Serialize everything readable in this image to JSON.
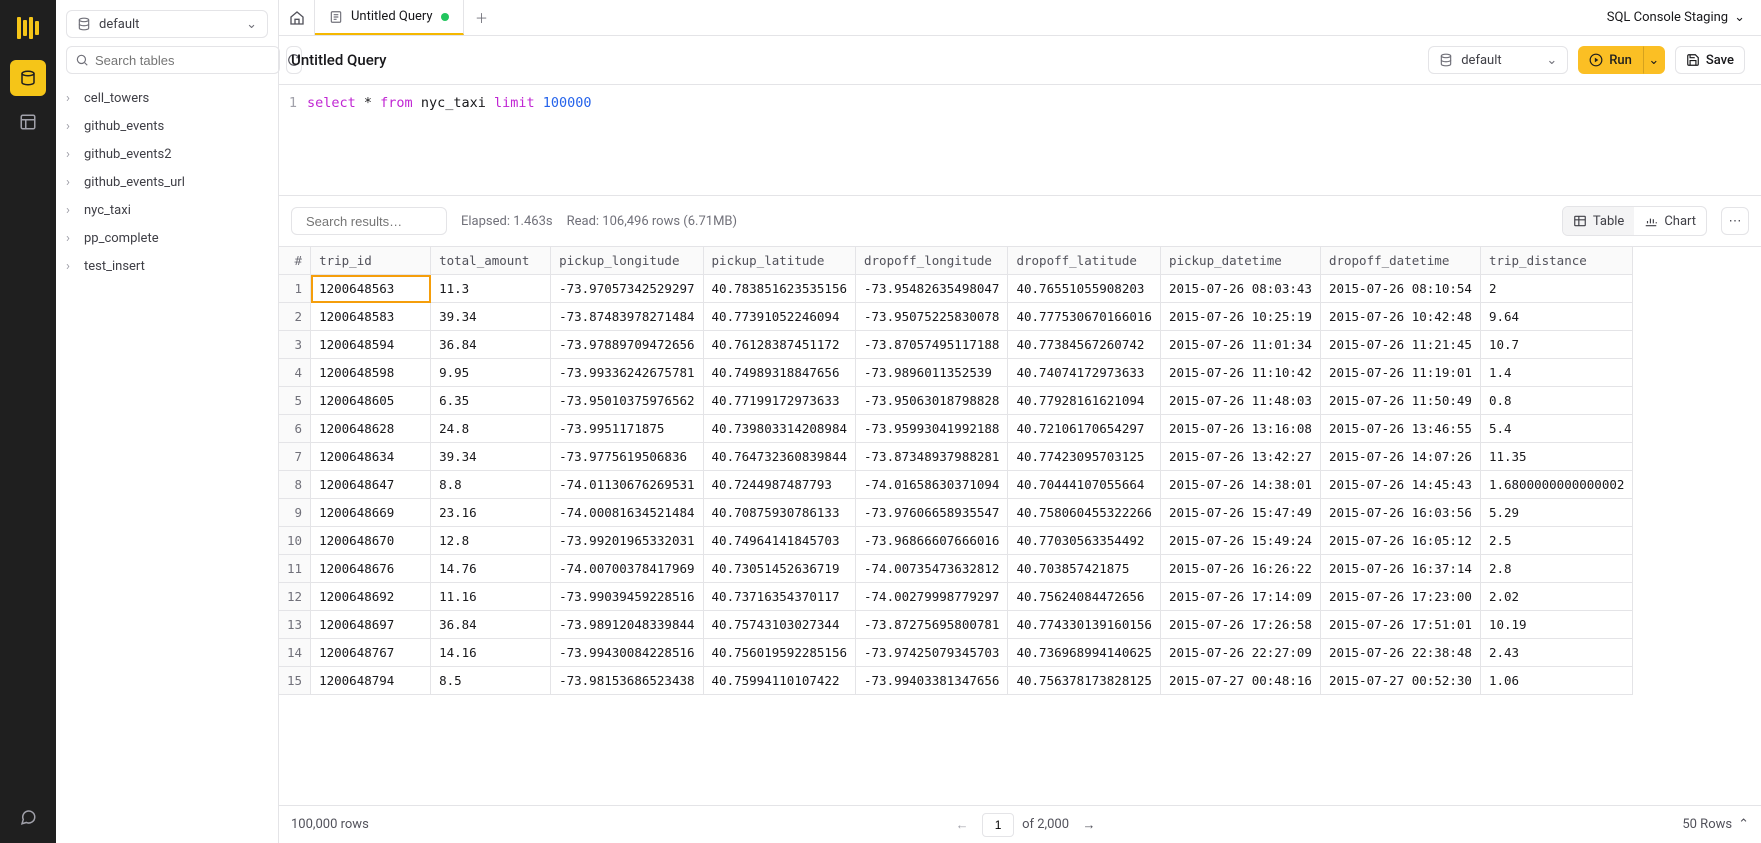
{
  "header": {
    "env_label": "SQL Console Staging"
  },
  "sidebar": {
    "db_selected": "default",
    "search_placeholder": "Search tables",
    "tables": [
      "cell_towers",
      "github_events",
      "github_events2",
      "github_events_url",
      "nyc_taxi",
      "pp_complete",
      "test_insert"
    ]
  },
  "tabs": {
    "active": {
      "label": "Untitled Query"
    }
  },
  "toolbar": {
    "title": "Untitled Query",
    "run_db": "default",
    "run_label": "Run",
    "save_label": "Save"
  },
  "editor": {
    "line_no": "1",
    "tok_select": "select",
    "tok_star": " * ",
    "tok_from": "from",
    "tok_table": " nyc_taxi ",
    "tok_limit": "limit",
    "tok_num": " 100000"
  },
  "results": {
    "search_placeholder": "Search results…",
    "elapsed": "Elapsed: 1.463s",
    "read": "Read: 106,496 rows (6.71MB)",
    "view_table": "Table",
    "view_chart": "Chart",
    "columns": [
      "#",
      "trip_id",
      "total_amount",
      "pickup_longitude",
      "pickup_latitude",
      "dropoff_longitude",
      "dropoff_latitude",
      "pickup_datetime",
      "dropoff_datetime",
      "trip_distance"
    ],
    "rows": [
      [
        "1",
        "1200648563",
        "11.3",
        "-73.97057342529297",
        "40.783851623535156",
        "-73.95482635498047",
        "40.76551055908203",
        "2015-07-26 08:03:43",
        "2015-07-26 08:10:54",
        "2"
      ],
      [
        "2",
        "1200648583",
        "39.34",
        "-73.87483978271484",
        "40.77391052246094",
        "-73.95075225830078",
        "40.777530670166016",
        "2015-07-26 10:25:19",
        "2015-07-26 10:42:48",
        "9.64"
      ],
      [
        "3",
        "1200648594",
        "36.84",
        "-73.97889709472656",
        "40.76128387451172",
        "-73.87057495117188",
        "40.77384567260742",
        "2015-07-26 11:01:34",
        "2015-07-26 11:21:45",
        "10.7"
      ],
      [
        "4",
        "1200648598",
        "9.95",
        "-73.99336242675781",
        "40.74989318847656",
        "-73.9896011352539",
        "40.74074172973633",
        "2015-07-26 11:10:42",
        "2015-07-26 11:19:01",
        "1.4"
      ],
      [
        "5",
        "1200648605",
        "6.35",
        "-73.95010375976562",
        "40.77199172973633",
        "-73.95063018798828",
        "40.77928161621094",
        "2015-07-26 11:48:03",
        "2015-07-26 11:50:49",
        "0.8"
      ],
      [
        "6",
        "1200648628",
        "24.8",
        "-73.9951171875",
        "40.739803314208984",
        "-73.95993041992188",
        "40.72106170654297",
        "2015-07-26 13:16:08",
        "2015-07-26 13:46:55",
        "5.4"
      ],
      [
        "7",
        "1200648634",
        "39.34",
        "-73.9775619506836",
        "40.764732360839844",
        "-73.87348937988281",
        "40.77423095703125",
        "2015-07-26 13:42:27",
        "2015-07-26 14:07:26",
        "11.35"
      ],
      [
        "8",
        "1200648647",
        "8.8",
        "-74.01130676269531",
        "40.7244987487793",
        "-74.01658630371094",
        "40.70444107055664",
        "2015-07-26 14:38:01",
        "2015-07-26 14:45:43",
        "1.6800000000000002"
      ],
      [
        "9",
        "1200648669",
        "23.16",
        "-74.00081634521484",
        "40.70875930786133",
        "-73.97606658935547",
        "40.758060455322266",
        "2015-07-26 15:47:49",
        "2015-07-26 16:03:56",
        "5.29"
      ],
      [
        "10",
        "1200648670",
        "12.8",
        "-73.99201965332031",
        "40.74964141845703",
        "-73.96866607666016",
        "40.77030563354492",
        "2015-07-26 15:49:24",
        "2015-07-26 16:05:12",
        "2.5"
      ],
      [
        "11",
        "1200648676",
        "14.76",
        "-74.00700378417969",
        "40.73051452636719",
        "-74.00735473632812",
        "40.703857421875",
        "2015-07-26 16:26:22",
        "2015-07-26 16:37:14",
        "2.8"
      ],
      [
        "12",
        "1200648692",
        "11.16",
        "-73.99039459228516",
        "40.73716354370117",
        "-74.00279998779297",
        "40.75624084472656",
        "2015-07-26 17:14:09",
        "2015-07-26 17:23:00",
        "2.02"
      ],
      [
        "13",
        "1200648697",
        "36.84",
        "-73.98912048339844",
        "40.75743103027344",
        "-73.87275695800781",
        "40.774330139160156",
        "2015-07-26 17:26:58",
        "2015-07-26 17:51:01",
        "10.19"
      ],
      [
        "14",
        "1200648767",
        "14.16",
        "-73.99430084228516",
        "40.756019592285156",
        "-73.97425079345703",
        "40.736968994140625",
        "2015-07-26 22:27:09",
        "2015-07-26 22:38:48",
        "2.43"
      ],
      [
        "15",
        "1200648794",
        "8.5",
        "-73.98153686523438",
        "40.75994110107422",
        "-73.99403381347656",
        "40.756378173828125",
        "2015-07-27 00:48:16",
        "2015-07-27 00:52:30",
        "1.06"
      ]
    ]
  },
  "footer": {
    "total_rows": "100,000 rows",
    "page": "1",
    "page_total": "of 2,000",
    "rows_sel": "50 Rows"
  }
}
